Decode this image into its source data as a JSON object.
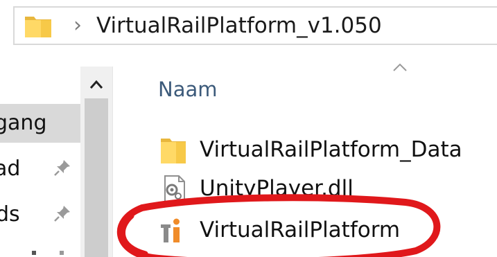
{
  "address_bar": {
    "path": "VirtualRailPlatform_v1.050",
    "folder_icon": "folder-icon",
    "separator": "›"
  },
  "nav_pane": {
    "items": [
      {
        "label": "gang",
        "pinned": false,
        "selected": true
      },
      {
        "label": "ad",
        "pinned": true,
        "selected": false
      },
      {
        "label": "ds",
        "pinned": true,
        "selected": false
      }
    ],
    "scroll_up_glyph": "^"
  },
  "file_list": {
    "column_header": "Naam",
    "sort_glyph": "^",
    "files": [
      {
        "name": "VirtualRailPlatform_Data",
        "icon": "folder-icon"
      },
      {
        "name": "UnityPlayer.dll",
        "icon": "dll-file-icon"
      },
      {
        "name": "VirtualRailPlatform",
        "icon": "application-icon"
      }
    ]
  },
  "colors": {
    "folder_yellow": "#ffd966",
    "folder_dark": "#e8b73d",
    "selection_gray": "#d9d9d9",
    "annotation_red": "#e0181b",
    "header_blue": "#3c5a7a"
  }
}
